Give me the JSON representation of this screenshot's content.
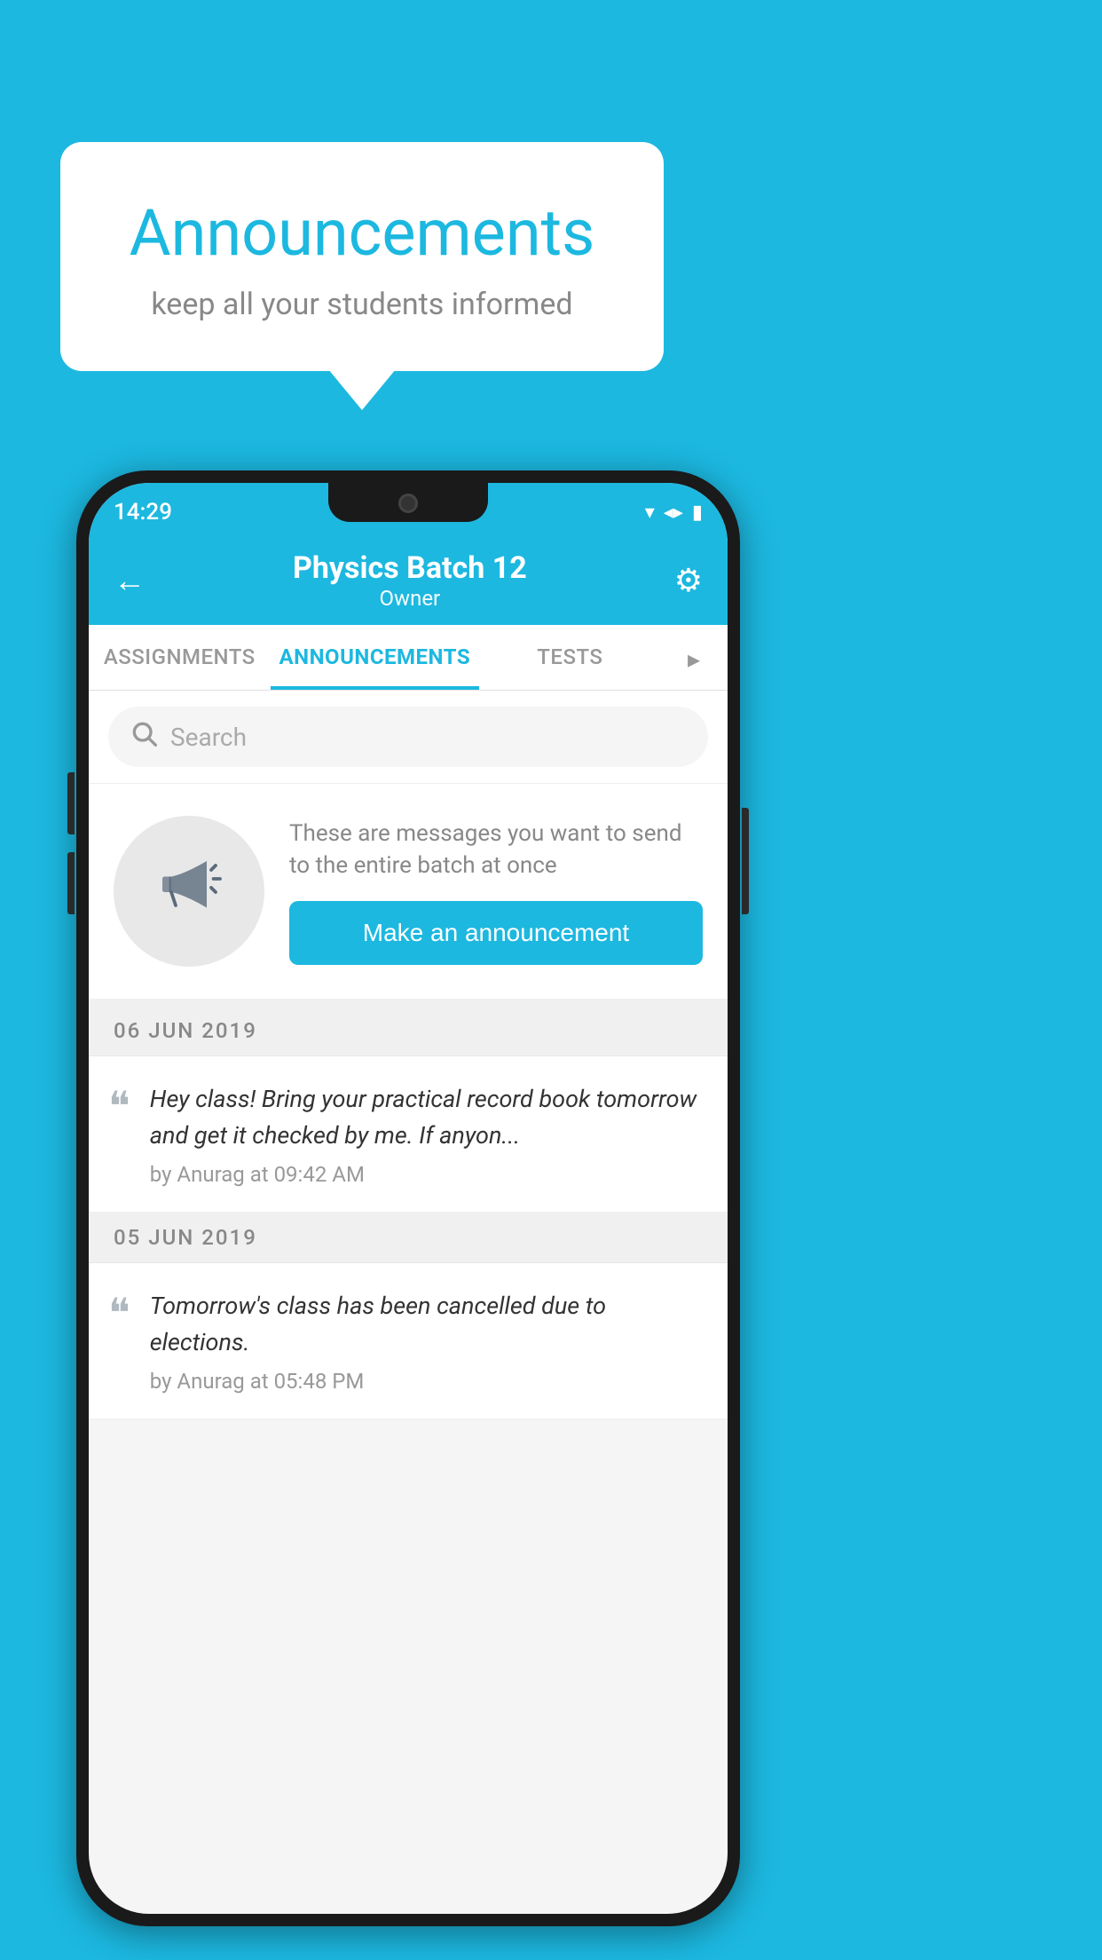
{
  "background_color": "#1cb8e0",
  "speech_bubble": {
    "title": "Announcements",
    "subtitle": "keep all your students informed"
  },
  "phone": {
    "status_bar": {
      "time": "14:29",
      "icons": [
        "wifi",
        "signal",
        "battery"
      ]
    },
    "header": {
      "back_label": "←",
      "title": "Physics Batch 12",
      "subtitle": "Owner",
      "gear_label": "⚙"
    },
    "tabs": [
      {
        "label": "ASSIGNMENTS",
        "active": false
      },
      {
        "label": "ANNOUNCEMENTS",
        "active": true
      },
      {
        "label": "TESTS",
        "active": false
      },
      {
        "label": "...",
        "active": false
      }
    ],
    "search": {
      "placeholder": "Search"
    },
    "promo": {
      "description": "These are messages you want to send to the entire batch at once",
      "button_label": "Make an announcement"
    },
    "announcements": [
      {
        "date": "06  JUN  2019",
        "text": "Hey class! Bring your practical record book tomorrow and get it checked by me. If anyon...",
        "meta": "by Anurag at 09:42 AM"
      },
      {
        "date": "05  JUN  2019",
        "text": "Tomorrow's class has been cancelled due to elections.",
        "meta": "by Anurag at 05:48 PM"
      }
    ]
  }
}
